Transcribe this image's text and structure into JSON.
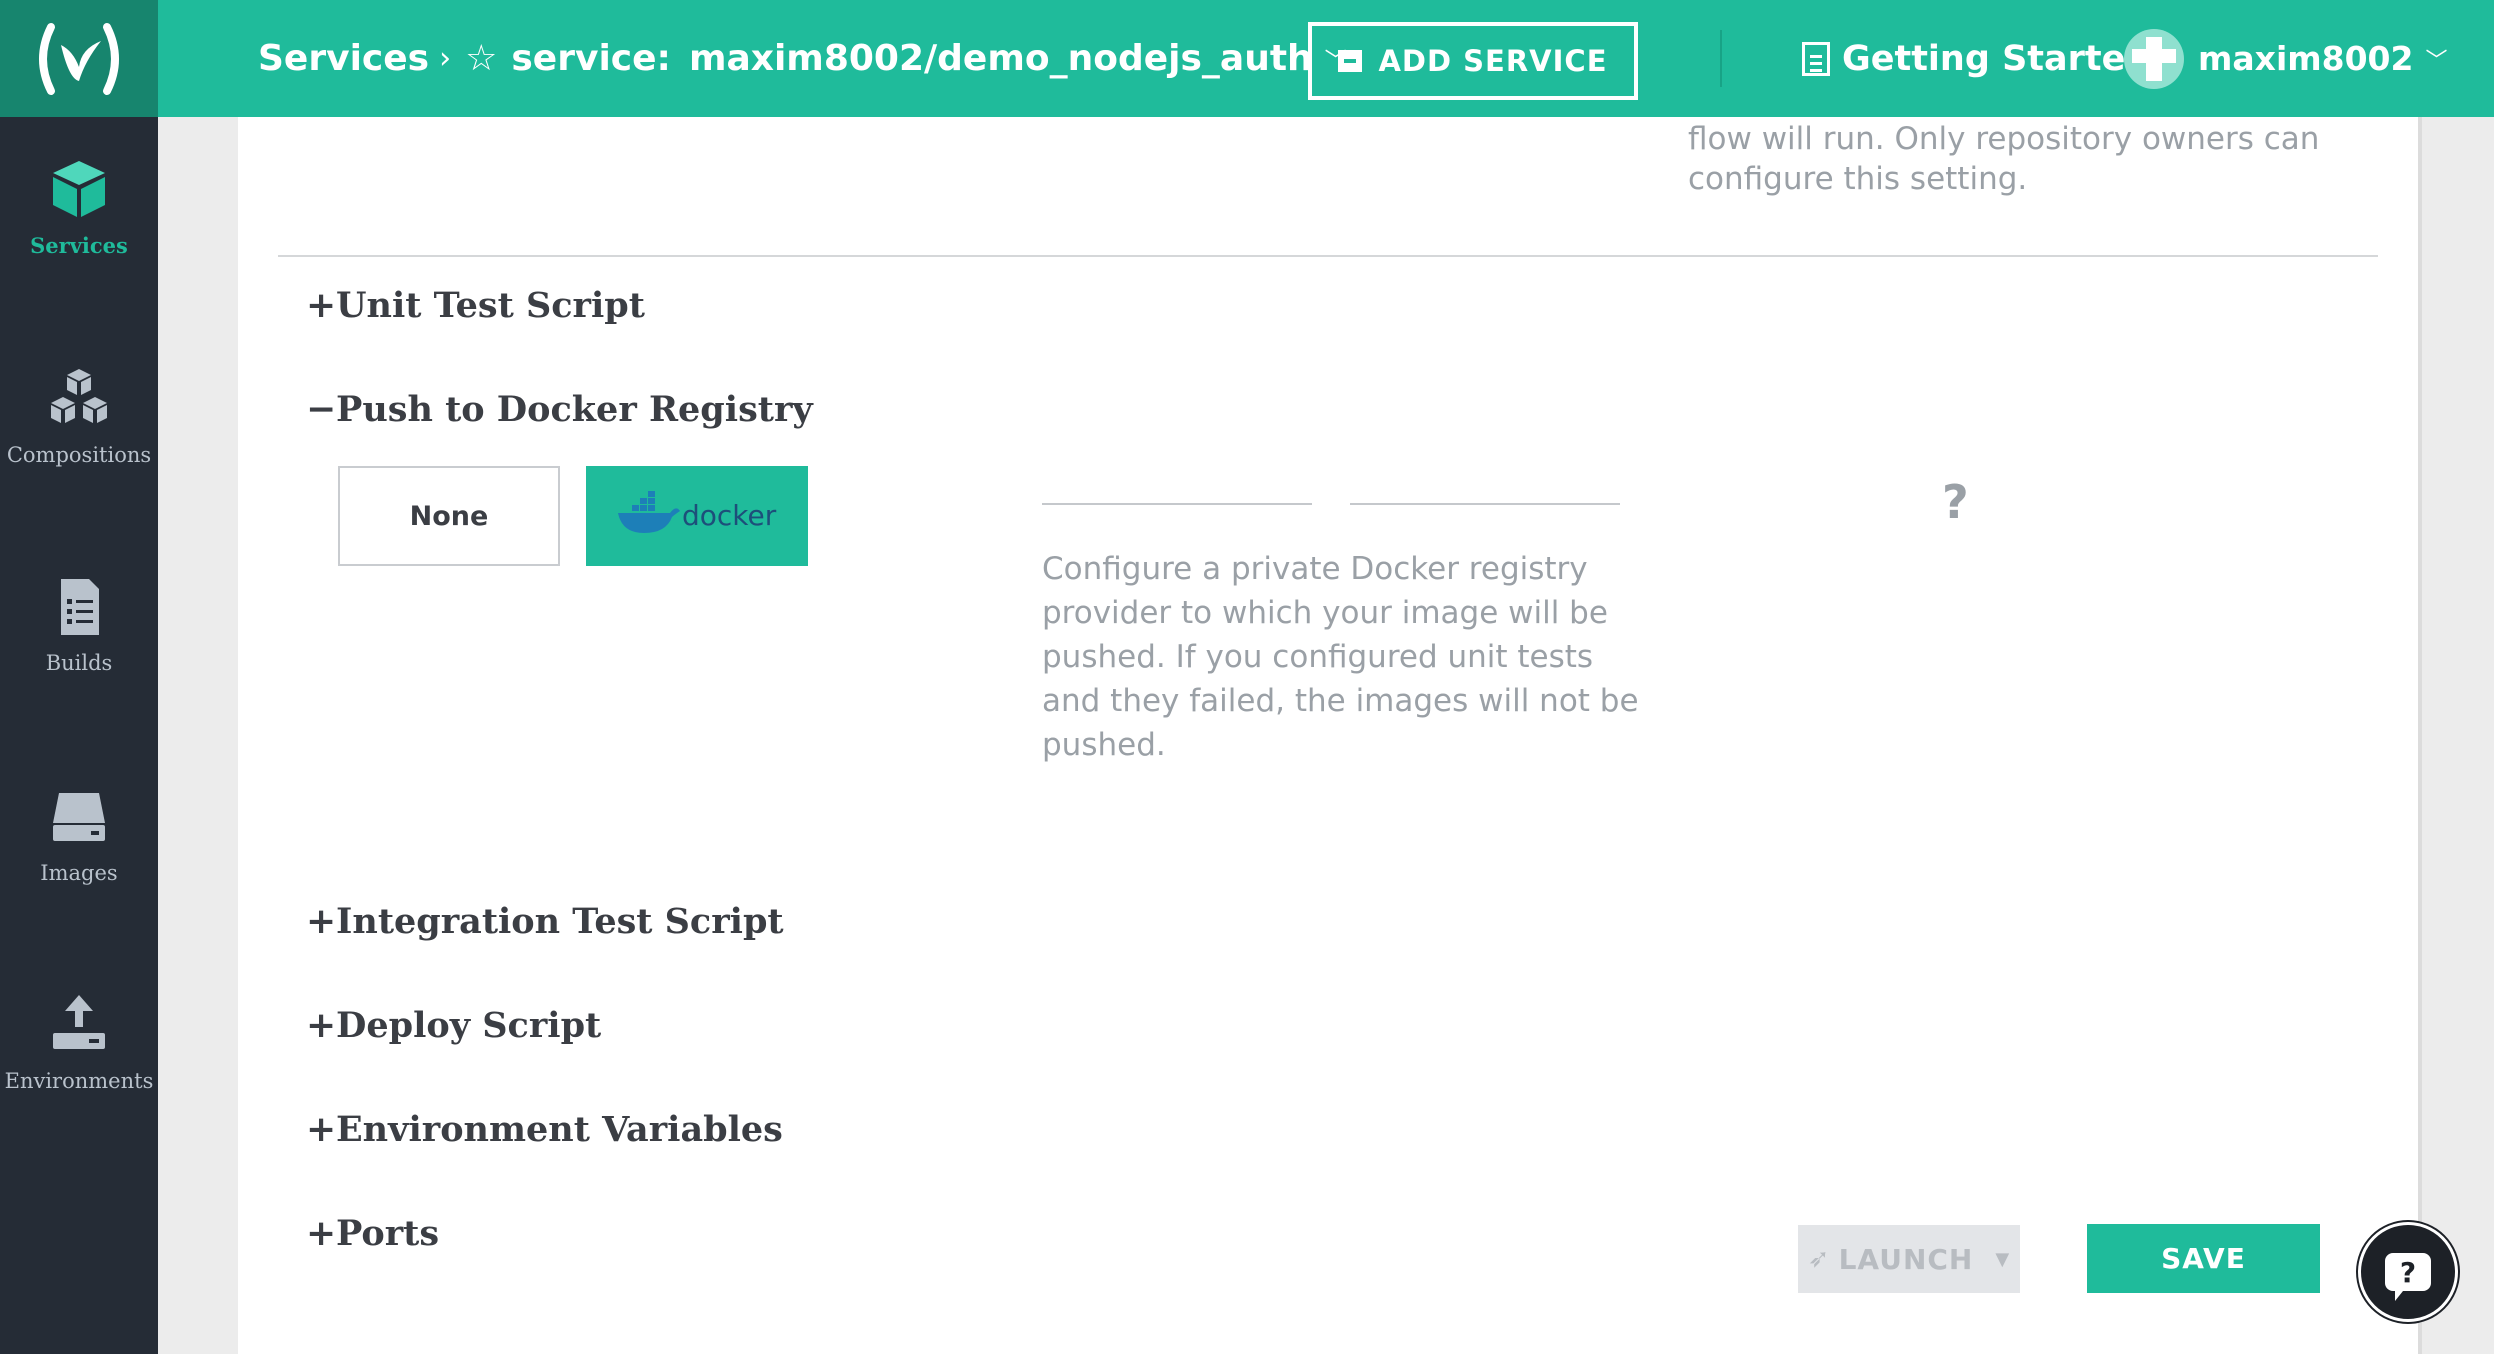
{
  "header": {
    "breadcrumb_root": "Services",
    "breadcrumb_sep": "›",
    "service_label": "service:",
    "service_name": "maxim8002/demo_nodejs_auth",
    "add_service_label": "ADD SERVICE",
    "getting_started_label": "Getting Started",
    "username": "maxim8002"
  },
  "sidebar": {
    "items": [
      {
        "label": "Services",
        "icon": "cube-icon",
        "active": true
      },
      {
        "label": "Compositions",
        "icon": "cubes-icon",
        "active": false
      },
      {
        "label": "Builds",
        "icon": "document-list-icon",
        "active": false
      },
      {
        "label": "Images",
        "icon": "drive-icon",
        "active": false
      },
      {
        "label": "Environments",
        "icon": "upload-icon",
        "active": false
      }
    ]
  },
  "main": {
    "top_help_line1": "flow will run. Only repository owners can",
    "top_help_line2": "configure this setting.",
    "sections": [
      {
        "sign": "+",
        "title": "Unit Test Script"
      },
      {
        "sign": "−",
        "title": "Push to Docker Registry"
      },
      {
        "sign": "+",
        "title": "Integration Test Script"
      },
      {
        "sign": "+",
        "title": "Deploy Script"
      },
      {
        "sign": "+",
        "title": "Environment Variables"
      },
      {
        "sign": "+",
        "title": "Ports"
      }
    ],
    "registry_options": {
      "none_label": "None",
      "docker_label": "docker",
      "selected": "docker"
    },
    "help_mark": "?",
    "registry_help": "Configure a private Docker registry provider to which your image will be pushed. If you configured unit tests and they failed, the images will not be pushed.",
    "launch_label": "LAUNCH",
    "save_label": "SAVE",
    "help_fab_label": "?"
  },
  "colors": {
    "brand": "#1fbb9b",
    "brand_dark": "#17856e",
    "sidebar_bg": "#252c36"
  }
}
